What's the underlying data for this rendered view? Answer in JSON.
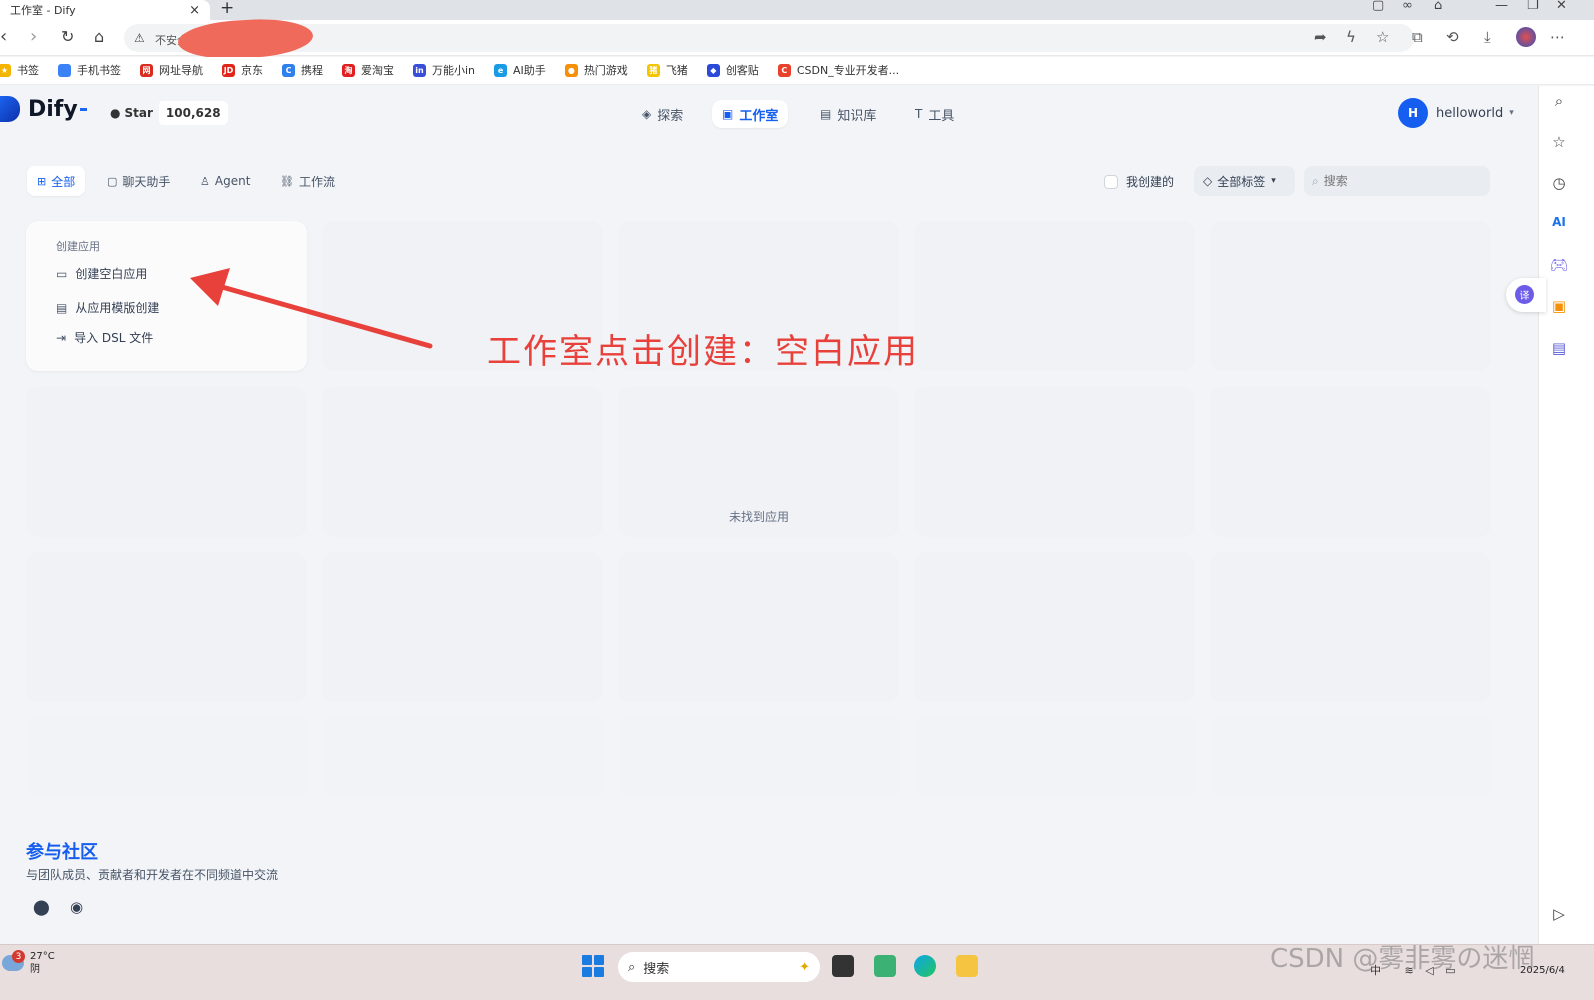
{
  "browser": {
    "tab_title": "工作室 - Dify",
    "tab_close": "×",
    "new_tab": "+",
    "address_warning": "不安全",
    "bookmarks": [
      {
        "label": "书签",
        "color": "#f5b400",
        "glyph": "★"
      },
      {
        "label": "手机书签",
        "color": "#3b82f6",
        "glyph": ""
      },
      {
        "label": "网址导航",
        "color": "#d92d20",
        "glyph": "网"
      },
      {
        "label": "京东",
        "color": "#e1251b",
        "glyph": "JD"
      },
      {
        "label": "携程",
        "color": "#2f80ed",
        "glyph": "C"
      },
      {
        "label": "爱淘宝",
        "color": "#e02020",
        "glyph": "淘"
      },
      {
        "label": "万能小in",
        "color": "#3a4fd8",
        "glyph": "in"
      },
      {
        "label": "AI助手",
        "color": "#1a9be6",
        "glyph": "e"
      },
      {
        "label": "热门游戏",
        "color": "#f79009",
        "glyph": "●"
      },
      {
        "label": "飞猪",
        "color": "#f5c400",
        "glyph": "猪"
      },
      {
        "label": "创客贴",
        "color": "#2b4ad9",
        "glyph": "◆"
      },
      {
        "label": "CSDN_专业开发者...",
        "color": "#e8412c",
        "glyph": "C"
      }
    ]
  },
  "app": {
    "logo_text": "Dify",
    "github_star_label": "Star",
    "github_star_count": "100,628",
    "nav": [
      {
        "label": "探索",
        "icon": "compass-icon",
        "glyph": "◈",
        "active": false
      },
      {
        "label": "工作室",
        "icon": "robot-icon",
        "glyph": "▣",
        "active": true
      },
      {
        "label": "知识库",
        "icon": "book-icon",
        "glyph": "▤",
        "active": false
      },
      {
        "label": "工具",
        "icon": "hammer-icon",
        "glyph": "T",
        "active": false
      }
    ],
    "user": {
      "initial": "H",
      "name": "helloworld"
    }
  },
  "filters": {
    "tabs": [
      {
        "label": "全部",
        "glyph": "⊞",
        "active": true
      },
      {
        "label": "聊天助手",
        "glyph": "▢",
        "active": false
      },
      {
        "label": "Agent",
        "glyph": "♙",
        "active": false
      },
      {
        "label": "工作流",
        "glyph": "⛓",
        "active": false
      }
    ],
    "created_by_me": "我创建的",
    "tags_label": "全部标签",
    "search_placeholder": "搜索"
  },
  "create_card": {
    "title": "创建应用",
    "items": [
      {
        "label": "创建空白应用",
        "glyph": "▭"
      },
      {
        "label": "从应用模版创建",
        "glyph": "▤"
      },
      {
        "label": "导入 DSL 文件",
        "glyph": "⇥"
      }
    ]
  },
  "empty_text": "未找到应用",
  "annotation": "工作室点击创建：空白应用",
  "community": {
    "title": "参与社区",
    "subtitle": "与团队成员、贡献者和开发者在不同频道中交流"
  },
  "taskbar": {
    "temperature": "27°C",
    "weather": "阴",
    "notification_count": "3",
    "search_label": "搜索",
    "tray_ime": "中",
    "date": "2025/6/4"
  },
  "watermark": "CSDN @雾非雾の迷惘"
}
